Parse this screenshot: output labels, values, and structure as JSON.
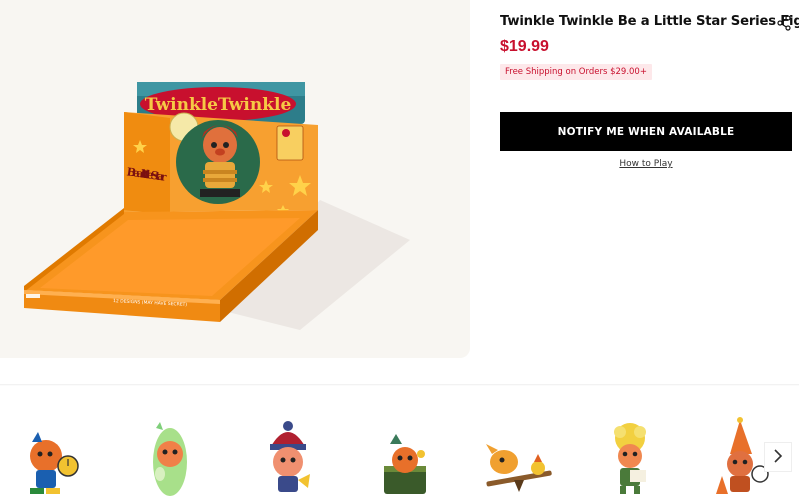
{
  "product": {
    "title": "Twinkle Twinkle Be a Little Star Series Figures",
    "price": "$19.99",
    "shipping_note": "Free Shipping on Orders $29.00+",
    "notify_label": "NOTIFY ME WHEN AVAILABLE",
    "how_to_play": "How to Play"
  },
  "box": {
    "header_text": "TwinkleTwinkle",
    "side_text": "Be a little Star",
    "front_text": "12 DESIGNS (MAY HAVE SECRET)",
    "colors": {
      "orange": "#f7941d",
      "orange_dark": "#e07a00",
      "header_teal": "#2d7d8a",
      "header_red": "#c8102e",
      "yellow": "#f6c945"
    }
  },
  "thumbnails": [
    {
      "name": "figure-clock"
    },
    {
      "name": "figure-green-hood"
    },
    {
      "name": "figure-knit-hat"
    },
    {
      "name": "figure-treasure-box"
    },
    {
      "name": "figure-seesaw"
    },
    {
      "name": "figure-flower-hair"
    },
    {
      "name": "figure-party-hat"
    }
  ],
  "icons": {
    "share": "share-icon",
    "next": "chevron-right-icon"
  }
}
